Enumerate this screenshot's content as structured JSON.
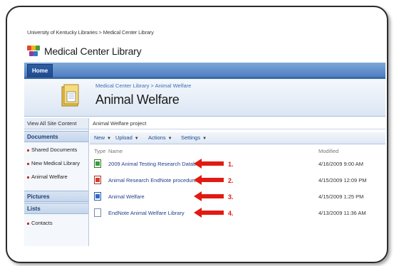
{
  "breadcrumb_top": "University of Kentucky Libraries > Medical Center Library",
  "site_title": "Medical Center Library",
  "tabs": [
    {
      "label": "Home"
    }
  ],
  "page": {
    "breadcrumb": "Medical Center Library > Animal Welfare",
    "title": "Animal Welfare"
  },
  "leftnav": {
    "view_all": "View All Site Content",
    "sections": [
      {
        "heading": "Documents",
        "items": [
          "Shared Documents",
          "New Medical Library",
          "Animal Welfare"
        ]
      },
      {
        "heading": "Pictures",
        "items": []
      },
      {
        "heading": "Lists",
        "items": [
          "Contacts"
        ]
      }
    ]
  },
  "content": {
    "description": "Animal Welfare project",
    "toolbar": [
      "New",
      "Upload",
      "Actions",
      "Settings"
    ],
    "columns": {
      "type": "Type",
      "name": "Name",
      "modified": "Modified"
    },
    "rows": [
      {
        "icon": "excel-icon",
        "name": "2009 Animal Testing Research Database",
        "marker": "1.",
        "modified": "4/16/2009 9:00 AM"
      },
      {
        "icon": "endnote-icon",
        "name": "Animal Research EndNote procedures",
        "marker": "2.",
        "modified": "4/15/2009 12:09 PM"
      },
      {
        "icon": "word-icon",
        "name": "Animal Welfare",
        "marker": "3.",
        "modified": "4/15/2009 1:25 PM"
      },
      {
        "icon": "generic-file-icon",
        "name": "EndNote Animal Welfare Library",
        "marker": "4.",
        "modified": "4/13/2009 11:36 AM"
      }
    ]
  },
  "colors": {
    "accent_blue": "#4f7fc3",
    "arrow_red": "#e21a12",
    "link_blue": "#1f3f8a"
  }
}
